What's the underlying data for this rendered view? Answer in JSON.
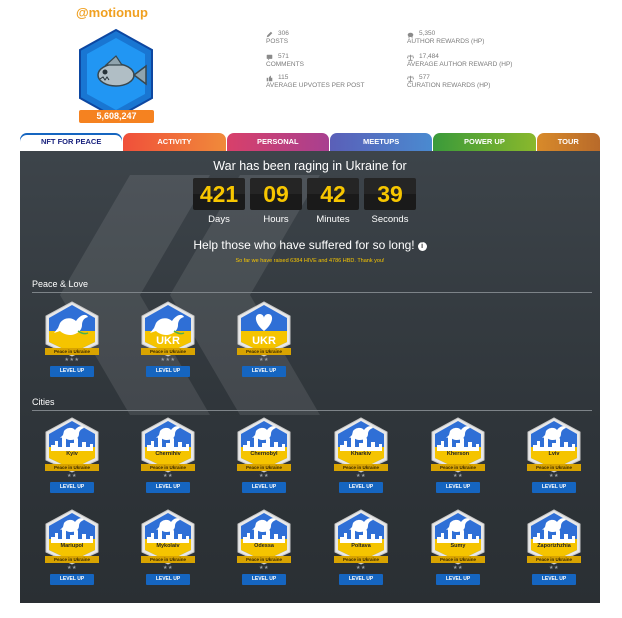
{
  "profile": {
    "username": "@motionup",
    "score": "5,608,247",
    "colors": {
      "accent": "#f0a020",
      "hex": "#1976d2"
    }
  },
  "stats": [
    {
      "icon": "pencil-icon",
      "value": "306",
      "label": "POSTS"
    },
    {
      "icon": "comments-icon",
      "value": "571",
      "label": "COMMENTS"
    },
    {
      "icon": "thumbs-up-icon",
      "value": "115",
      "label": "AVERAGE UPVOTES PER POST"
    },
    {
      "icon": "piggy-bank-icon",
      "value": "5,350",
      "label": "AUTHOR REWARDS (HP)"
    },
    {
      "icon": "scale-icon",
      "value": "17,484",
      "label": "AVERAGE AUTHOR REWARD (HP)"
    },
    {
      "icon": "scale-icon",
      "value": "577",
      "label": "CURATION REWARDS (HP)"
    }
  ],
  "tabs": [
    {
      "label": "NFT FOR PEACE",
      "color": "#ffffff"
    },
    {
      "label": "ACTIVITY",
      "color": "#e8503a"
    },
    {
      "label": "PERSONAL",
      "color": "#c2407a"
    },
    {
      "label": "MEETUPS",
      "color": "#4a6fb8"
    },
    {
      "label": "POWER UP",
      "color": "#5aa02c"
    },
    {
      "label": "TOUR",
      "color": "#c8782a"
    }
  ],
  "war": {
    "title": "War has been raging in Ukraine for",
    "timer": [
      {
        "value": "421",
        "label": "Days"
      },
      {
        "value": "09",
        "label": "Hours"
      },
      {
        "value": "42",
        "label": "Minutes"
      },
      {
        "value": "39",
        "label": "Seconds"
      }
    ],
    "help": "Help those who have suffered for so long!",
    "raised": "So far we have raised 6384 HIVE and 4786 HBD. Thank you!"
  },
  "peace": {
    "title": "Peace & Love",
    "badges": [
      {
        "label": "Peace in Ukraine",
        "stars": "★★★",
        "button": "LEVEL UP",
        "emblem": "dove-icon",
        "text": ""
      },
      {
        "label": "Peace in Ukraine",
        "stars": "★★★",
        "button": "LEVEL UP",
        "emblem": "dove-icon",
        "text": "UKR"
      },
      {
        "label": "Peace in Ukraine",
        "stars": "★★",
        "button": "LEVEL UP",
        "emblem": "heart-icon",
        "text": "UKR"
      }
    ]
  },
  "cities": {
    "title": "Cities",
    "badges": [
      {
        "name": "Kyiv",
        "label": "Peace in Ukraine",
        "stars": "★★",
        "button": "LEVEL UP"
      },
      {
        "name": "Chernihiv",
        "label": "Peace in Ukraine",
        "stars": "★★",
        "button": "LEVEL UP"
      },
      {
        "name": "Chernobyl",
        "label": "Peace in Ukraine",
        "stars": "★★",
        "button": "LEVEL UP"
      },
      {
        "name": "Kharkiv",
        "label": "Peace in Ukraine",
        "stars": "★★",
        "button": "LEVEL UP"
      },
      {
        "name": "Kherson",
        "label": "Peace in Ukraine",
        "stars": "★★",
        "button": "LEVEL UP"
      },
      {
        "name": "Lviv",
        "label": "Peace in Ukraine",
        "stars": "★★",
        "button": "LEVEL UP"
      },
      {
        "name": "Mariupol",
        "label": "Peace in Ukraine",
        "stars": "★★",
        "button": "LEVEL UP"
      },
      {
        "name": "Mykolaiv",
        "label": "Peace in Ukraine",
        "stars": "★★",
        "button": "LEVEL UP"
      },
      {
        "name": "Odessa",
        "label": "Peace in Ukraine",
        "stars": "★★",
        "button": "LEVEL UP"
      },
      {
        "name": "Poltava",
        "label": "Peace in Ukraine",
        "stars": "★★",
        "button": "LEVEL UP"
      },
      {
        "name": "Sumy",
        "label": "Peace in Ukraine",
        "stars": "★★",
        "button": "LEVEL UP"
      },
      {
        "name": "Zaporizhzhia",
        "label": "Peace in Ukraine",
        "stars": "★★",
        "button": "LEVEL UP"
      }
    ]
  }
}
